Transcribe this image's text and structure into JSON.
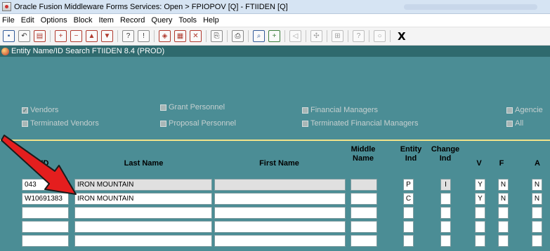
{
  "window": {
    "title": "Oracle Fusion Middleware Forms Services:  Open > FPIOPOV [Q] - FTIIDEN [Q]"
  },
  "menu": [
    "File",
    "Edit",
    "Options",
    "Block",
    "Item",
    "Record",
    "Query",
    "Tools",
    "Help"
  ],
  "toolbar": {
    "exit_label": "X"
  },
  "form": {
    "title": "Entity Name/ID Search  FTIIDEN  8.4  (PROD)"
  },
  "filters": {
    "vendors": {
      "label": "Vendors",
      "checked": true
    },
    "terminated_vendors": {
      "label": "Terminated Vendors",
      "checked": false
    },
    "grant_personnel": {
      "label": "Grant Personnel",
      "checked": false
    },
    "proposal_personnel": {
      "label": "Proposal Personnel",
      "checked": false
    },
    "financial_managers": {
      "label": "Financial Managers",
      "checked": false
    },
    "terminated_financial_managers": {
      "label": "Terminated Financial Managers",
      "checked": false
    },
    "agencies": {
      "label": "Agencie",
      "checked": false
    },
    "all": {
      "label": "All",
      "checked": false
    }
  },
  "columns": {
    "id": "ID",
    "last_name": "Last Name",
    "first_name": "First Name",
    "middle_name_1": "Middle",
    "middle_name_2": "Name",
    "entity_ind_1": "Entity",
    "entity_ind_2": "Ind",
    "change_ind_1": "Change",
    "change_ind_2": "Ind",
    "v": "V",
    "f": "F",
    "a": "A"
  },
  "rows": [
    {
      "id": "043",
      "last_name": "IRON MOUNTAIN",
      "first_name": "",
      "middle_name": "",
      "entity_ind": "P",
      "change_ind": "I",
      "v": "Y",
      "f": "N",
      "a": "N"
    },
    {
      "id": "W10691383",
      "last_name": "IRON MOUNTAIN",
      "first_name": "",
      "middle_name": "",
      "entity_ind": "C",
      "change_ind": "",
      "v": "Y",
      "f": "N",
      "a": "N"
    },
    {
      "id": "",
      "last_name": "",
      "first_name": "",
      "middle_name": "",
      "entity_ind": "",
      "change_ind": "",
      "v": "",
      "f": "",
      "a": ""
    },
    {
      "id": "",
      "last_name": "",
      "first_name": "",
      "middle_name": "",
      "entity_ind": "",
      "change_ind": "",
      "v": "",
      "f": "",
      "a": ""
    },
    {
      "id": "",
      "last_name": "",
      "first_name": "",
      "middle_name": "",
      "entity_ind": "",
      "change_ind": "",
      "v": "",
      "f": "",
      "a": ""
    }
  ],
  "colors": {
    "canvas": "#4b8d95",
    "header_bar": "#2f6a6e",
    "separator": "#f2e38a",
    "annotation_arrow": "#e41e1e"
  }
}
